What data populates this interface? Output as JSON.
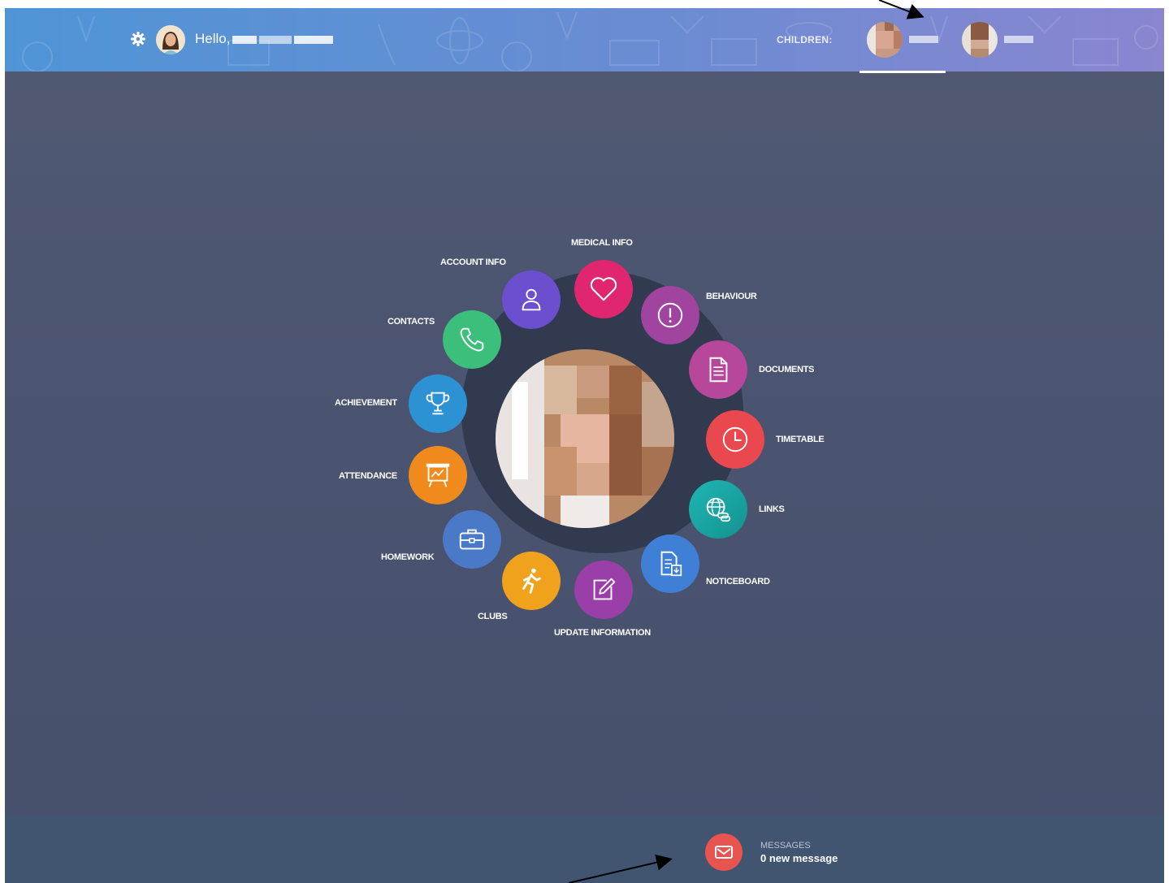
{
  "header": {
    "greeting": "Hello,",
    "children_label": "CHILDREN:"
  },
  "menu": [
    {
      "id": "medical-info",
      "label": "MEDICAL INFO",
      "color": "#e0266f",
      "icon": "heart-icon"
    },
    {
      "id": "behaviour",
      "label": "BEHAVIOUR",
      "color": "#a0449f",
      "icon": "alert-icon"
    },
    {
      "id": "documents",
      "label": "DOCUMENTS",
      "color": "#b6479a",
      "icon": "document-icon"
    },
    {
      "id": "timetable",
      "label": "TIMETABLE",
      "color": "#e9484e",
      "icon": "clock-icon"
    },
    {
      "id": "links",
      "label": "LINKS",
      "color": "#1eb6b4",
      "icon": "globe-link-icon"
    },
    {
      "id": "noticeboard",
      "label": "NOTICEBOARD",
      "color": "#3f7fd6",
      "icon": "noticeboard-icon"
    },
    {
      "id": "update-information",
      "label": "UPDATE INFORMATION",
      "color": "#9a3fa8",
      "icon": "edit-icon"
    },
    {
      "id": "clubs",
      "label": "CLUBS",
      "color": "#f0a21c",
      "icon": "running-icon"
    },
    {
      "id": "homework",
      "label": "HOMEWORK",
      "color": "#4a79c8",
      "icon": "briefcase-icon"
    },
    {
      "id": "attendance",
      "label": "ATTENDANCE",
      "color": "#f08a1c",
      "icon": "presentation-icon"
    },
    {
      "id": "achievement",
      "label": "ACHIEVEMENT",
      "color": "#2d92d3",
      "icon": "trophy-icon"
    },
    {
      "id": "contacts",
      "label": "CONTACTS",
      "color": "#3bbf7a",
      "icon": "phone-icon"
    },
    {
      "id": "account-info",
      "label": "ACCOUNT INFO",
      "color": "#6b4fcf",
      "icon": "user-icon"
    }
  ],
  "messages": {
    "title": "MESSAGES",
    "count_text": "0 new message"
  }
}
